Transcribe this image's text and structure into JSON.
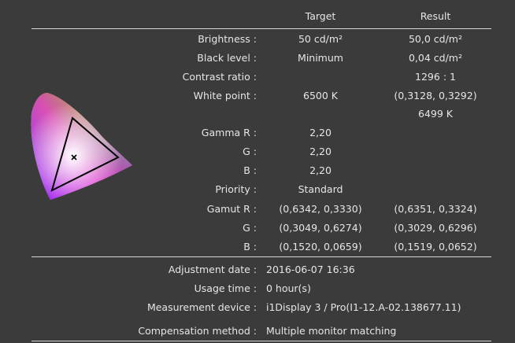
{
  "header": {
    "target": "Target",
    "result": "Result"
  },
  "rows": [
    {
      "label": "Brightness :",
      "target": "50 cd/m²",
      "result": "50,0 cd/m²"
    },
    {
      "label": "Black level :",
      "target": "Minimum",
      "result": "0,04 cd/m²"
    },
    {
      "label": "Contrast ratio :",
      "target": "",
      "result": "1296 : 1"
    },
    {
      "label": "White point :",
      "target": "6500 K",
      "result": "(0,3128, 0,3292)"
    },
    {
      "label": "",
      "target": "",
      "result": "6499 K"
    },
    {
      "label": "Gamma R :",
      "target": "2,20",
      "result": ""
    },
    {
      "label": "G :",
      "target": "2,20",
      "result": ""
    },
    {
      "label": "B :",
      "target": "2,20",
      "result": ""
    },
    {
      "label": "Priority :",
      "target": "Standard",
      "result": ""
    },
    {
      "label": "Gamut R :",
      "target": "(0,6342, 0,3330)",
      "result": "(0,6351, 0,3324)"
    },
    {
      "label": "G :",
      "target": "(0,3049, 0,6274)",
      "result": "(0,3029, 0,6296)"
    },
    {
      "label": "B :",
      "target": "(0,1520, 0,0659)",
      "result": "(0,1519, 0,0652)"
    }
  ],
  "info": [
    {
      "label": "Adjustment date :",
      "value": "2016-06-07 16:36"
    },
    {
      "label": "Usage time :",
      "value": "0 hour(s)"
    },
    {
      "label": "Measurement device :",
      "value": "i1Display 3 / Pro(I1-12.A-02.138677.11)"
    },
    {
      "label": "Compensation method :",
      "value": "Multiple monitor matching"
    }
  ],
  "diagram": {
    "icon": "cie-chromaticity-diagram-icon"
  },
  "colors": {
    "background": "#3b3b3b",
    "text": "#e6e6e6",
    "rule": "#d6d6d6"
  }
}
